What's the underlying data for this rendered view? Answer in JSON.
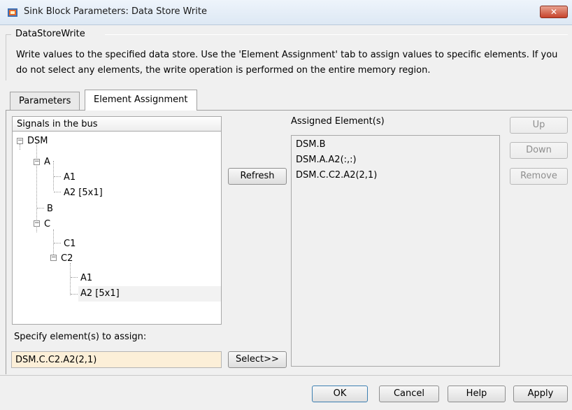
{
  "window": {
    "title": "Sink Block Parameters: Data Store Write",
    "close_glyph": "✕"
  },
  "block": {
    "name": "DataStoreWrite",
    "description": "Write values to the specified data store. Use the 'Element Assignment' tab to assign values to specific elements. If you do not select any elements, the write operation is performed on the entire memory region."
  },
  "tabs": [
    {
      "label": "Parameters",
      "active": false
    },
    {
      "label": "Element Assignment",
      "active": true
    }
  ],
  "tree": {
    "header": "Signals in the bus",
    "nodes": [
      {
        "label": "DSM",
        "expanded": true,
        "selected": false
      },
      {
        "label": "A",
        "expanded": true,
        "selected": false
      },
      {
        "label": "A1",
        "selected": false
      },
      {
        "label": "A2 [5x1]",
        "selected": false
      },
      {
        "label": "B",
        "selected": false
      },
      {
        "label": "C",
        "expanded": true,
        "selected": false
      },
      {
        "label": "C1",
        "selected": false
      },
      {
        "label": "C2",
        "expanded": true,
        "selected": false
      },
      {
        "label": "A1",
        "selected": false
      },
      {
        "label": "A2 [5x1]",
        "selected": true
      }
    ],
    "expander_glyph": "−"
  },
  "actions": {
    "refresh": "Refresh",
    "select": "Select>>"
  },
  "assigned": {
    "label": "Assigned Element(s)",
    "items": [
      "DSM.B",
      "DSM.A.A2(:,:)",
      "DSM.C.C2.A2(2,1)"
    ]
  },
  "order_buttons": {
    "up": "Up",
    "down": "Down",
    "remove": "Remove"
  },
  "specify": {
    "label": "Specify element(s) to assign:",
    "value": "DSM.C.C2.A2(2,1)"
  },
  "footer": {
    "ok": "OK",
    "cancel": "Cancel",
    "help": "Help",
    "apply": "Apply"
  },
  "colors": {
    "title_bar": "#dde8f4",
    "close_button": "#c7442c",
    "input_highlight": "#fcefd8"
  }
}
